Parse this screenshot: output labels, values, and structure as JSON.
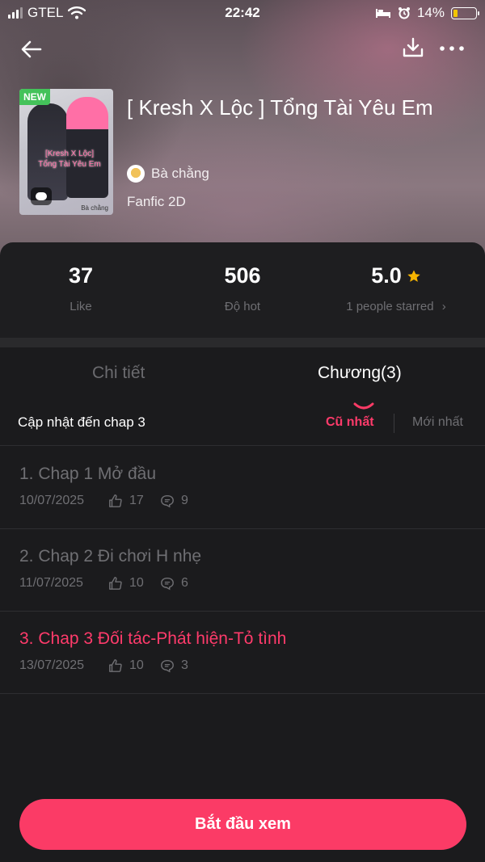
{
  "status_bar": {
    "carrier": "GTEL",
    "time": "22:42",
    "battery": "14%"
  },
  "story": {
    "badge": "NEW",
    "title": "[ Kresh X Lộc ] Tổng Tài Yêu Em",
    "author": "Bà chằng",
    "genre": "Fanfic 2D",
    "cover_text": "[Kresh X Lộc] Tổng Tài Yêu Em",
    "cover_credit": "Bà chằng"
  },
  "stats": {
    "likes": {
      "value": "37",
      "label": "Like"
    },
    "hot": {
      "value": "506",
      "label": "Độ hot"
    },
    "rating": {
      "value": "5.0",
      "label": "1 people starred",
      "suffix": "›"
    }
  },
  "tabs": {
    "detail": "Chi tiết",
    "chapters": "Chương(3)",
    "active": "chapters"
  },
  "chapter_list": {
    "update_label": "Cập nhật đến chap 3",
    "sort_oldest": "Cũ nhất",
    "sort_newest": "Mới nhất",
    "active_sort": "oldest",
    "items": [
      {
        "name": "1. Chap 1 Mở đầu",
        "date": "10/07/2025",
        "likes": "17",
        "comments": "9",
        "current": false
      },
      {
        "name": "2. Chap 2 Đi chơi H nhẹ",
        "date": "11/07/2025",
        "likes": "10",
        "comments": "6",
        "current": false
      },
      {
        "name": "3. Chap 3 Đối tác-Phát hiện-Tỏ tình",
        "date": "13/07/2025",
        "likes": "10",
        "comments": "3",
        "current": true
      }
    ]
  },
  "start_button": "Bắt đầu xem",
  "colors": {
    "accent": "#fb3b66",
    "background": "#1b1b1d",
    "muted_text": "#6f6f73",
    "badge_green": "#44c25a",
    "star": "#f7b500"
  }
}
